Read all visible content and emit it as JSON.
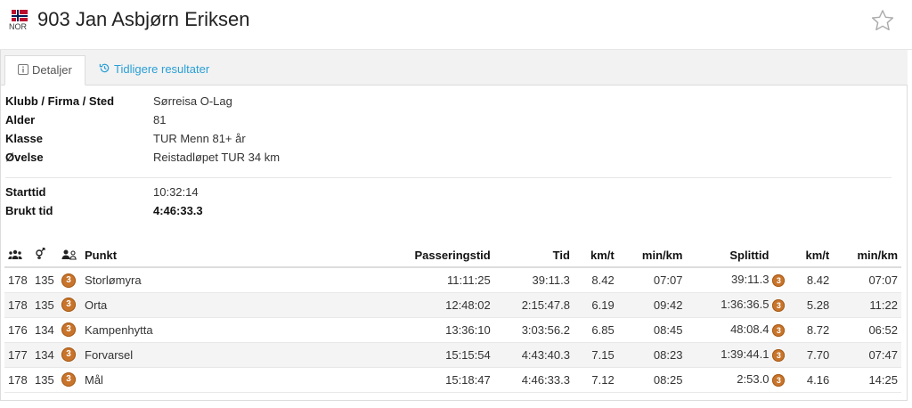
{
  "header": {
    "nationality": "NOR",
    "runner_name": "903 Jan Asbjørn Eriksen"
  },
  "tabs": [
    {
      "label": "Detaljer",
      "active": true
    },
    {
      "label": "Tidligere resultater",
      "active": false
    }
  ],
  "details": [
    {
      "label": "Klubb / Firma / Sted",
      "value": "Sørreisa O-Lag"
    },
    {
      "label": "Alder",
      "value": "81"
    },
    {
      "label": "Klasse",
      "value": "TUR Menn 81+ år"
    },
    {
      "label": "Øvelse",
      "value": "Reistadløpet TUR 34 km"
    }
  ],
  "timing": [
    {
      "label": "Starttid",
      "value": "10:32:14"
    },
    {
      "label": "Brukt tid",
      "value": "4:46:33.3"
    }
  ],
  "splits": {
    "headers": {
      "punkt": "Punkt",
      "passeringstid": "Passeringstid",
      "tid": "Tid",
      "kmt": "km/t",
      "minkm": "min/km",
      "splittid": "Splittid",
      "kmt2": "km/t",
      "minkm2": "min/km"
    },
    "rows": [
      {
        "overall": "178",
        "gender": "135",
        "class_rank": "3",
        "punkt": "Storlømyra",
        "passering": "11:11:25",
        "tid": "39:11.3",
        "kmt": "8.42",
        "minkm": "07:07",
        "split": "39:11.3",
        "split_rank": "3",
        "kmt2": "8.42",
        "minkm2": "07:07"
      },
      {
        "overall": "178",
        "gender": "135",
        "class_rank": "3",
        "punkt": "Orta",
        "passering": "12:48:02",
        "tid": "2:15:47.8",
        "kmt": "6.19",
        "minkm": "09:42",
        "split": "1:36:36.5",
        "split_rank": "3",
        "kmt2": "5.28",
        "minkm2": "11:22"
      },
      {
        "overall": "176",
        "gender": "134",
        "class_rank": "3",
        "punkt": "Kampenhytta",
        "passering": "13:36:10",
        "tid": "3:03:56.2",
        "kmt": "6.85",
        "minkm": "08:45",
        "split": "48:08.4",
        "split_rank": "3",
        "kmt2": "8.72",
        "minkm2": "06:52"
      },
      {
        "overall": "177",
        "gender": "134",
        "class_rank": "3",
        "punkt": "Forvarsel",
        "passering": "15:15:54",
        "tid": "4:43:40.3",
        "kmt": "7.15",
        "minkm": "08:23",
        "split": "1:39:44.1",
        "split_rank": "3",
        "kmt2": "7.70",
        "minkm2": "07:47"
      },
      {
        "overall": "178",
        "gender": "135",
        "class_rank": "3",
        "punkt": "Mål",
        "passering": "15:18:47",
        "tid": "4:46:33.3",
        "kmt": "7.12",
        "minkm": "08:25",
        "split": "2:53.0",
        "split_rank": "3",
        "kmt2": "4.16",
        "minkm2": "14:25"
      }
    ]
  },
  "colors": {
    "link": "#2a9fd6",
    "medal_bronze": "#c8742a",
    "flag_red": "#ba0c2f",
    "flag_blue": "#00205b"
  },
  "icons": [
    "norway-flag-icon",
    "star-icon",
    "info-icon",
    "history-icon",
    "group-icon",
    "gender-icon",
    "class-icon",
    "bronze-medal-icon"
  ]
}
